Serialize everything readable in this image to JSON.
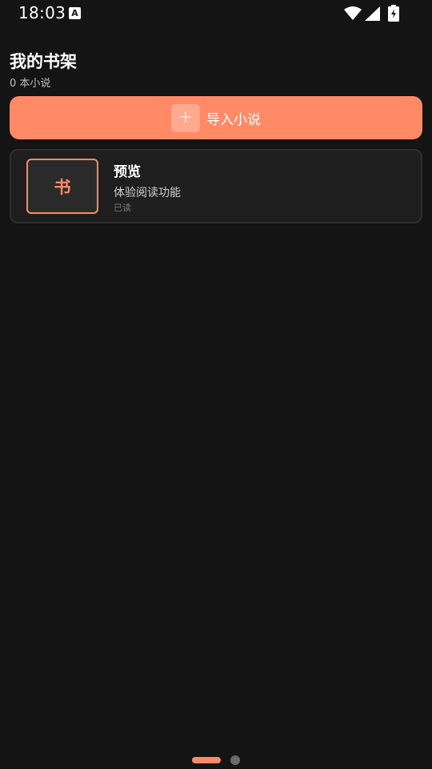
{
  "status_bar": {
    "time": "18:03",
    "notification_icon": "A",
    "icons": [
      "wifi-icon",
      "cell-signal-icon",
      "battery-charging-icon"
    ]
  },
  "header": {
    "title": "我的书架",
    "subtitle": "0 本小说"
  },
  "import_button": {
    "icon": "+",
    "label": "导入小说"
  },
  "books": [
    {
      "cover_text": "书",
      "title": "预览",
      "description": "体验阅读功能",
      "status": "已读"
    }
  ],
  "colors": {
    "background": "#141414",
    "accent": "#ff8a65",
    "card": "#1e1e1e"
  },
  "pager": {
    "pages": 2,
    "active": 1
  }
}
